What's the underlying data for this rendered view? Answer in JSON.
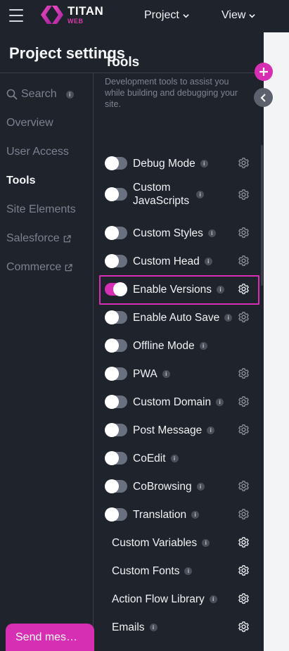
{
  "topbar": {
    "brand_name": "TITAN",
    "brand_sub": "WEB",
    "menus": [
      "Project",
      "View"
    ]
  },
  "panel": {
    "title": "Project settings"
  },
  "sidebar": {
    "items": [
      {
        "label": "Search",
        "info": "i"
      },
      {
        "label": "Overview"
      },
      {
        "label": "User Access"
      },
      {
        "label": "Tools"
      },
      {
        "label": "Site Elements"
      },
      {
        "label": "Salesforce"
      },
      {
        "label": "Commerce"
      }
    ]
  },
  "tools": {
    "title": "Tools",
    "description": "Development tools to assist you while building and debugging your site.",
    "items": [
      {
        "label": "Debug Mode",
        "toggle": true,
        "on": false,
        "gear": true
      },
      {
        "label": "Custom\nJavaScripts",
        "toggle": true,
        "on": false,
        "gear": true
      },
      {
        "label": "Custom Styles",
        "toggle": true,
        "on": false,
        "gear": true
      },
      {
        "label": "Custom Head",
        "toggle": true,
        "on": false,
        "gear": true
      },
      {
        "label": "Enable Versions",
        "toggle": true,
        "on": true,
        "gear": true
      },
      {
        "label": "Enable Auto Save",
        "toggle": true,
        "on": false,
        "gear": true
      },
      {
        "label": "Offline Mode",
        "toggle": true,
        "on": false,
        "gear": false
      },
      {
        "label": "PWA",
        "toggle": true,
        "on": false,
        "gear": true
      },
      {
        "label": "Custom Domain",
        "toggle": true,
        "on": false,
        "gear": true
      },
      {
        "label": "Post Message",
        "toggle": true,
        "on": false,
        "gear": true
      },
      {
        "label": "CoEdit",
        "toggle": true,
        "on": false,
        "gear": false
      },
      {
        "label": "CoBrowsing",
        "toggle": true,
        "on": false,
        "gear": true
      },
      {
        "label": "Translation",
        "toggle": true,
        "on": false,
        "gear": true
      },
      {
        "label": "Custom Variables",
        "toggle": false,
        "on": false,
        "gear": true
      },
      {
        "label": "Custom Fonts",
        "toggle": false,
        "on": false,
        "gear": true
      },
      {
        "label": "Action Flow Library",
        "toggle": false,
        "on": false,
        "gear": true
      },
      {
        "label": "Emails",
        "toggle": false,
        "on": false,
        "gear": true
      }
    ],
    "info_glyph": "i"
  },
  "chat": {
    "send_label": "Send mes…"
  },
  "colors": {
    "accent": "#d62fb4",
    "background": "#1f232b"
  }
}
